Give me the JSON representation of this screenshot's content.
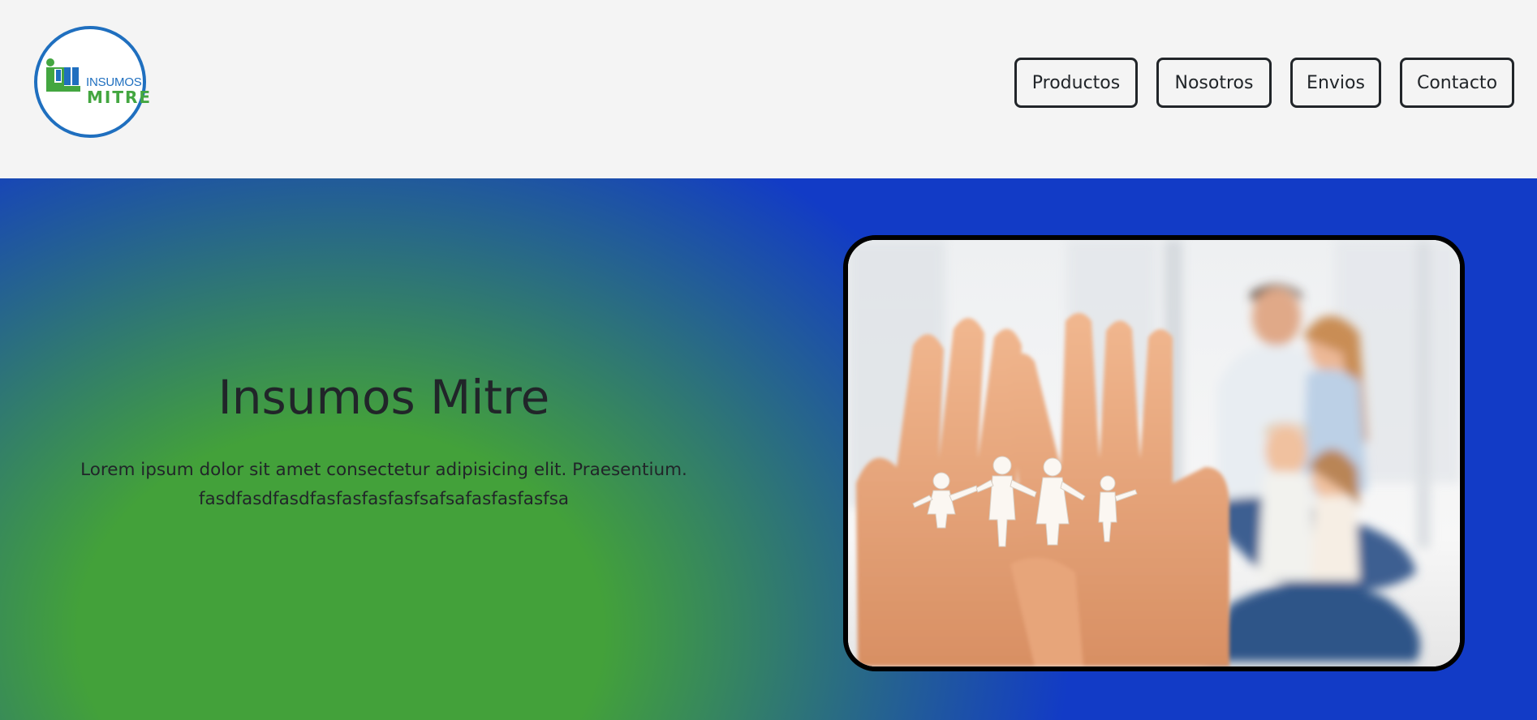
{
  "header": {
    "logo": {
      "line1": "INSUMOS",
      "line2": "MITRE"
    },
    "nav": [
      {
        "label": "Productos"
      },
      {
        "label": "Nosotros"
      },
      {
        "label": "Envios"
      },
      {
        "label": "Contacto"
      }
    ]
  },
  "hero": {
    "title": "Insumos Mitre",
    "text_line1": "Lorem ipsum dolor sit amet consectetur adipisicing elit. Praesentium.",
    "text_line2": "fasdfasdfasdfasfasfasfasfsafsafasfasfasfsa",
    "image_alt": "hands-holding-paper-family-photo"
  },
  "colors": {
    "header_bg": "#f4f4f4",
    "brand_blue": "#1f6fbf",
    "brand_green": "#43a640",
    "hero_green": "#43a13a",
    "hero_blue": "#123bc6",
    "text": "#212529"
  }
}
